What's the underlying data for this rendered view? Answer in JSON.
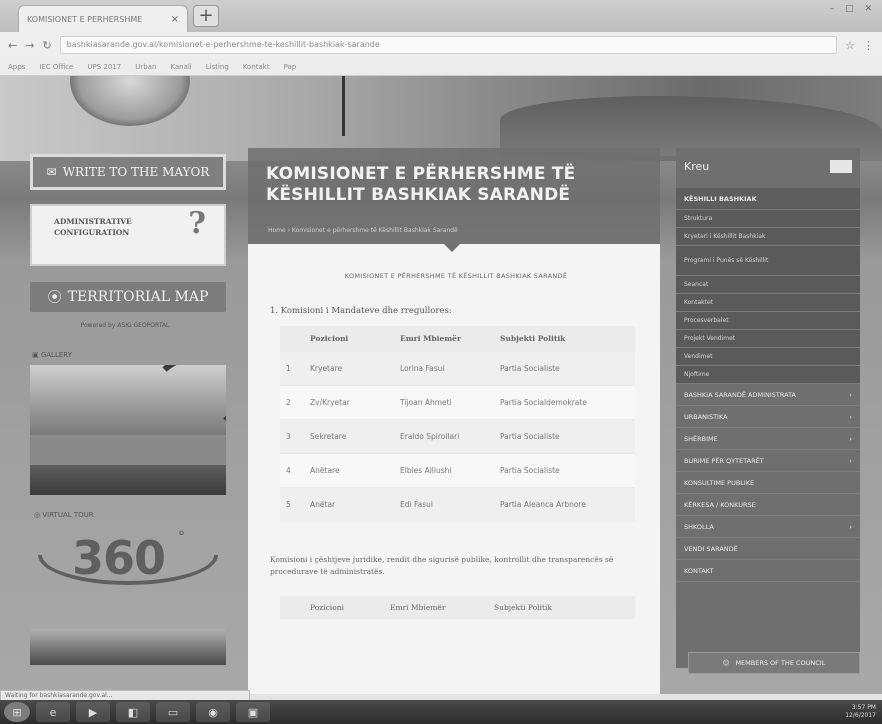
{
  "browser": {
    "tab_title": "KOMISIONET E PERHERSHME",
    "tab_close": "×",
    "new_tab": "+",
    "url": "bashkiasarande.gov.al/komisionet-e-perhershme-te-keshillit-bashkiak-sarande",
    "bookmarks": [
      "Apps",
      "IEC Office",
      "UPS 2017",
      "Urban",
      "Kanali",
      "Listing",
      "Kontakt",
      "Pap"
    ]
  },
  "left": {
    "write_mayor": "WRITE TO THE MAYOR",
    "admin_line1": "ADMINISTRATIVE",
    "admin_line2": "CONFIGURATION",
    "territorial_map": "TERRITORIAL MAP",
    "powered_by": "Powered by ASIG GEOPORTAL",
    "gallery": "GALLERY",
    "virtual_tour": "VIRTUAL TOUR",
    "tour_number": "360"
  },
  "center": {
    "title_line1": "KOMISIONET E PËRHERSHME TË",
    "title_line2": "KËSHILLIT BASHKIAK SARANDË",
    "breadcrumb": "Home › Komisionet e përhershme të Këshillit Bashkiak Sarandë",
    "subtitle": "KOMISIONET E PËRHERSHME TË KËSHILLIT BASHKIAK SARANDË",
    "section1": "1.   Komisioni i Mandateve dhe rregullores:",
    "headers": [
      "",
      "Pozicioni",
      "Emri Mbiemër",
      "Subjekti Politik"
    ],
    "rows": [
      [
        "1",
        "Kryetare",
        "Lorina  Fasui",
        "Partia Socialiste"
      ],
      [
        "2",
        "Zv/Kryetar",
        "Tijoan Ahmeti",
        "Partia Socialdemokrate"
      ],
      [
        "3",
        "Sekretare",
        "Eraldo Spirollari",
        "Partia Socialiste"
      ],
      [
        "4",
        "Anëtare",
        "Elbies Alliushi",
        "Partia Socialiste"
      ],
      [
        "5",
        "Anëtar",
        "Edi  Fasui",
        "Partia Aleanca Arbnore"
      ]
    ],
    "note": "Komisioni i çështjeve juridike, rendit dhe sigurisë publike, kontrollit dhe transparencës së procedurave të administratës.",
    "headers2": [
      "Pozicioni",
      "Emri Mbiemër",
      "Subjekti Politik"
    ]
  },
  "right": {
    "home": "Kreu",
    "items": [
      {
        "label": "KËSHILLI BASHKIAK",
        "type": "head"
      },
      {
        "label": "Struktura",
        "type": "sub"
      },
      {
        "label": "Kryetari i Këshillit Bashkiak",
        "type": "sub"
      },
      {
        "label": "Programi i Punës së Këshillit",
        "type": "sub"
      },
      {
        "label": "Seancat",
        "type": "sub"
      },
      {
        "label": "Kontaktet",
        "type": "sub"
      },
      {
        "label": "Procesverbalet",
        "type": "sub"
      },
      {
        "label": "Projekt Vendimet",
        "type": "sub"
      },
      {
        "label": "Vendimet",
        "type": "sub"
      },
      {
        "label": "Njoftime",
        "type": "sub"
      },
      {
        "label": "BASHKIA SARANDË ADMINISTRATA",
        "type": "item",
        "arrow": "›"
      },
      {
        "label": "URBANISTIKA",
        "type": "item",
        "arrow": "›"
      },
      {
        "label": "SHËRBIME",
        "type": "item",
        "arrow": "›"
      },
      {
        "label": "BURIME PËR QYTETARËT",
        "type": "item",
        "arrow": "›"
      },
      {
        "label": "KONSULTIME PUBLIKE",
        "type": "item",
        "arrow": ""
      },
      {
        "label": "KËRKESA / KONKURSE",
        "type": "item",
        "arrow": ""
      },
      {
        "label": "SHKOLLA",
        "type": "item",
        "arrow": "›"
      },
      {
        "label": "VENDI SARANDË",
        "type": "item",
        "arrow": ""
      },
      {
        "label": "KONTAKT",
        "type": "item",
        "arrow": ""
      }
    ],
    "council_btn": "MEMBERS OF THE COUNCIL"
  },
  "status_text": "Waiting for bashkiasarande.gov.al...",
  "taskbar": {
    "time": "3:57 PM",
    "date": "12/6/2017"
  }
}
